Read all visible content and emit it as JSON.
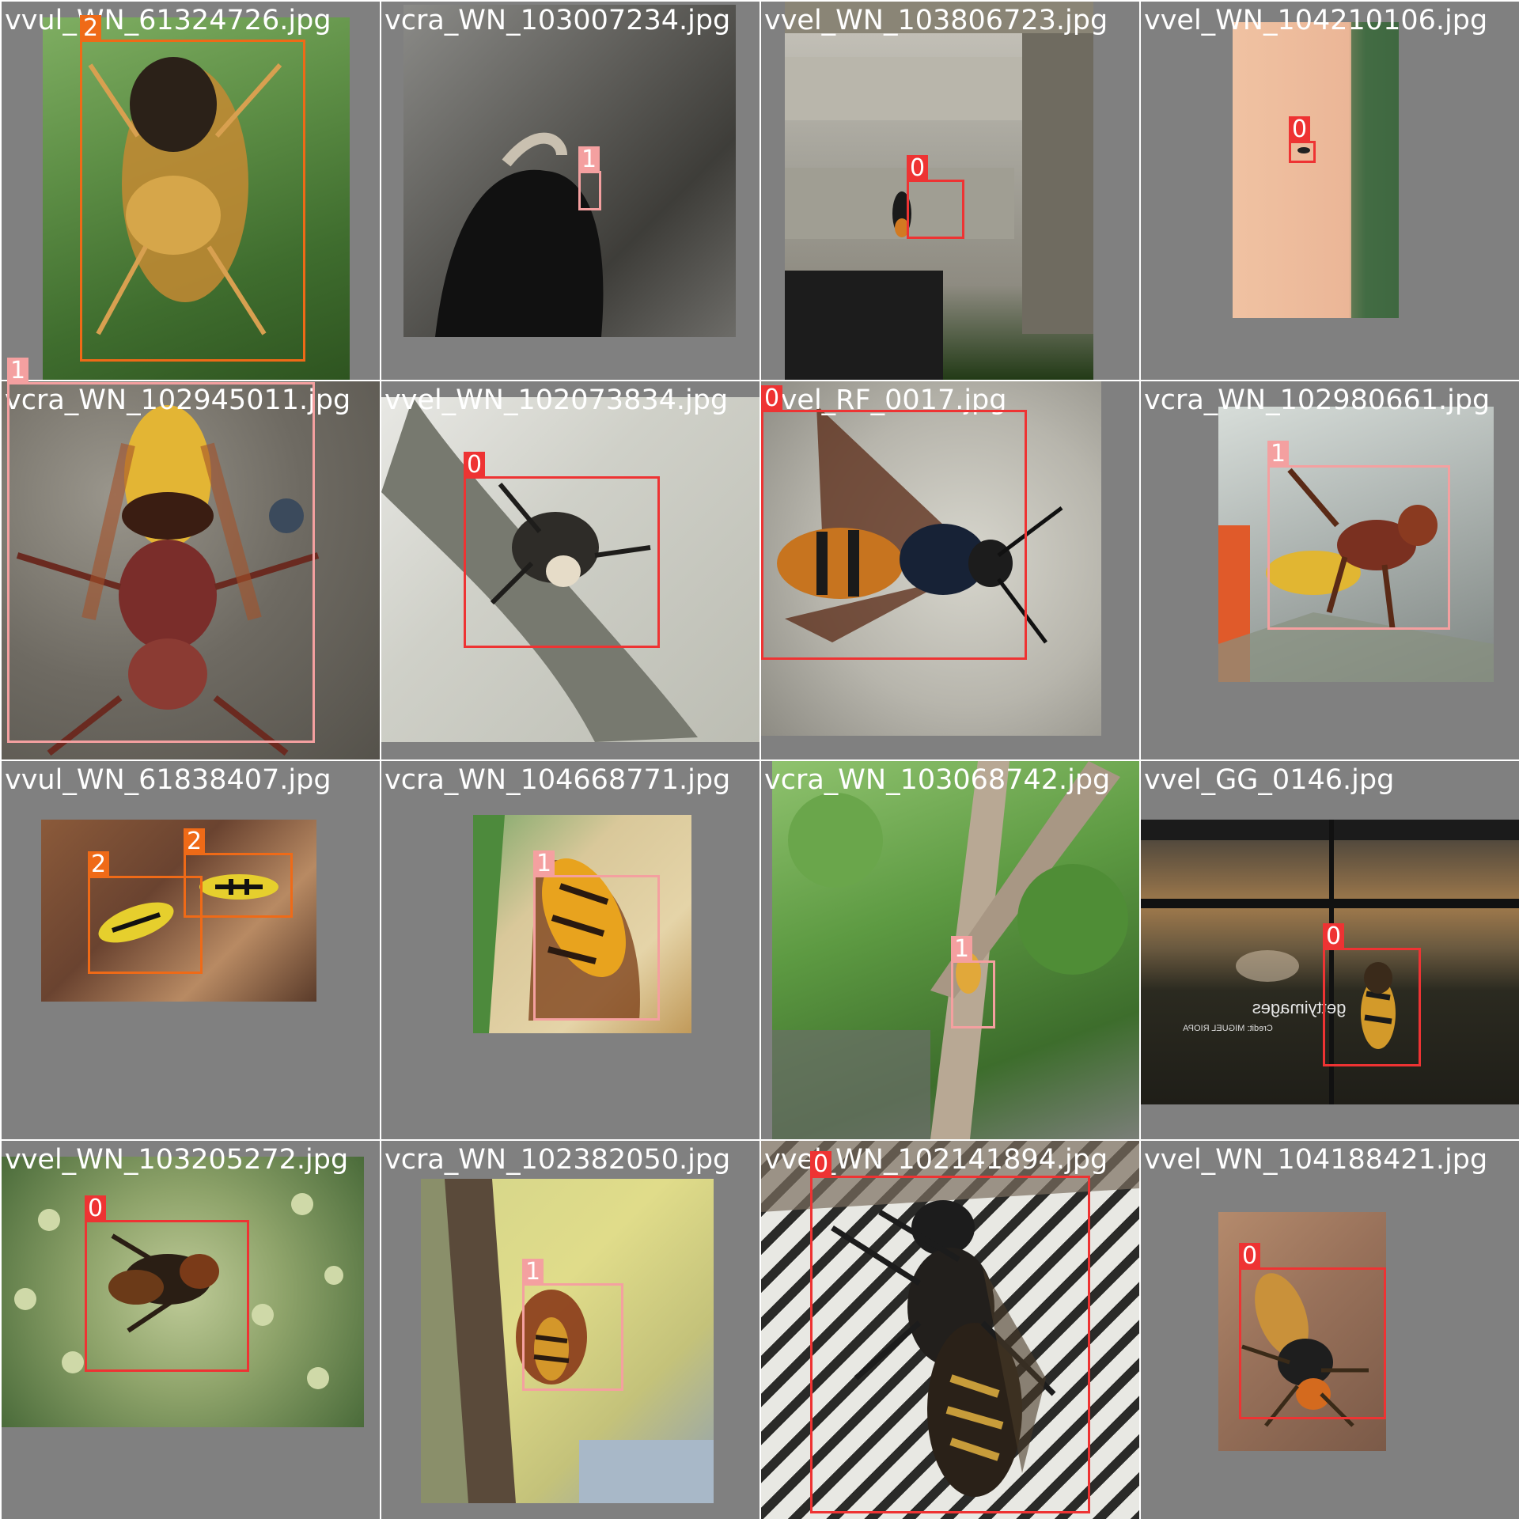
{
  "title": "",
  "colors": {
    "class_0": "#ee3333",
    "class_1": "#f4a0a0",
    "class_2": "#ef6a17",
    "tile_background": "#808080",
    "filename_text": "#ffffff"
  },
  "tiles": [
    {
      "filename": "vvul_WN_61324726.jpg",
      "detections": [
        {
          "label": "2"
        }
      ]
    },
    {
      "filename": "vcra_WN_103007234.jpg",
      "detections": [
        {
          "label": "1"
        }
      ]
    },
    {
      "filename": "vvel_WN_103806723.jpg",
      "detections": [
        {
          "label": "0"
        }
      ]
    },
    {
      "filename": "vvel_WN_104210106.jpg",
      "detections": [
        {
          "label": "0"
        }
      ]
    },
    {
      "filename": "vcra_WN_102945011.jpg",
      "detections": [
        {
          "label": "1"
        }
      ]
    },
    {
      "filename": "vvel_WN_102073834.jpg",
      "detections": [
        {
          "label": "0"
        }
      ]
    },
    {
      "filename": "vvel_RF_0017.jpg",
      "detections": [
        {
          "label": "0"
        }
      ]
    },
    {
      "filename": "vcra_WN_102980661.jpg",
      "detections": [
        {
          "label": "1"
        }
      ]
    },
    {
      "filename": "vvul_WN_61838407.jpg",
      "detections": [
        {
          "label": "2"
        },
        {
          "label": "2"
        }
      ]
    },
    {
      "filename": "vcra_WN_104668771.jpg",
      "detections": [
        {
          "label": "1"
        }
      ]
    },
    {
      "filename": "vcra_WN_103068742.jpg",
      "detections": [
        {
          "label": "1"
        }
      ]
    },
    {
      "filename": "vvel_GG_0146.jpg",
      "detections": [
        {
          "label": "0"
        }
      ],
      "watermark": [
        "gettyimages",
        "Credit: MIGUEL RIOPA"
      ]
    },
    {
      "filename": "vvel_WN_103205272.jpg",
      "detections": [
        {
          "label": "0"
        }
      ]
    },
    {
      "filename": "vcra_WN_102382050.jpg",
      "detections": [
        {
          "label": "1"
        }
      ]
    },
    {
      "filename": "vvel_WN_102141894.jpg",
      "detections": [
        {
          "label": "0"
        }
      ]
    },
    {
      "filename": "vvel_WN_104188421.jpg",
      "detections": [
        {
          "label": "0"
        }
      ]
    }
  ]
}
